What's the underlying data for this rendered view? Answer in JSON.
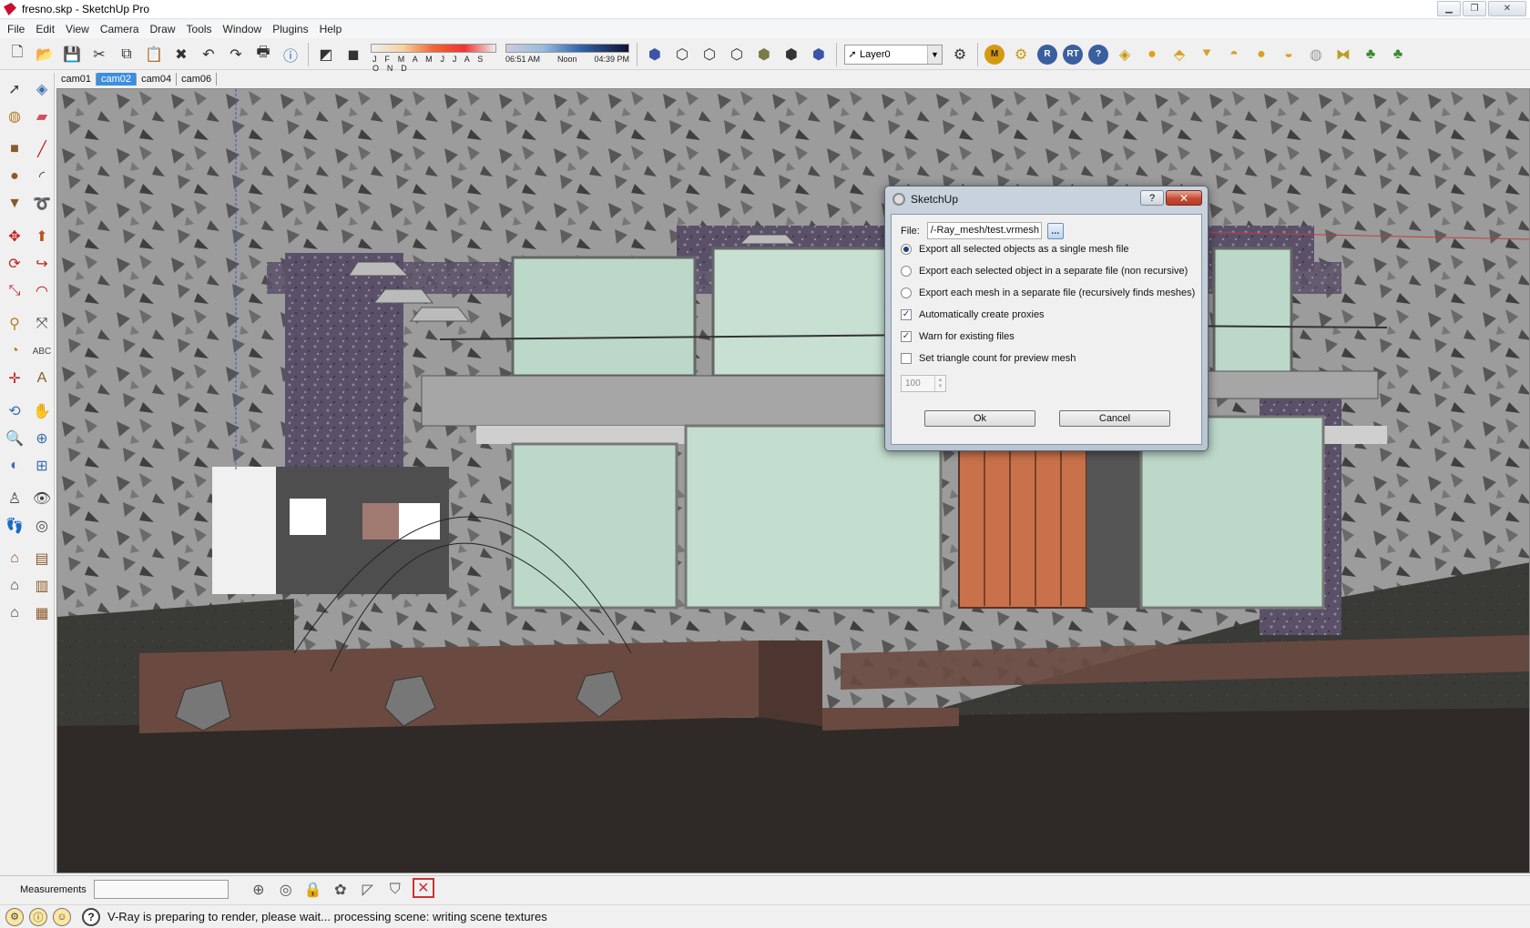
{
  "window": {
    "title": "fresno.skp - SketchUp Pro",
    "minimize_glyph": "▁",
    "restore_glyph": "❐",
    "close_glyph": "✕"
  },
  "menu": [
    "File",
    "Edit",
    "View",
    "Camera",
    "Draw",
    "Tools",
    "Window",
    "Plugins",
    "Help"
  ],
  "toolbar": {
    "months": "J F M A M J J A S O N D",
    "time_start": "06:51 AM",
    "time_noon": "Noon",
    "time_end": "04:39 PM",
    "layer": "Layer0",
    "vray_buttons": [
      "M",
      "R",
      "RT",
      "?"
    ]
  },
  "scene_tabs": [
    "cam01",
    "cam02",
    "cam04",
    "cam06"
  ],
  "active_tab": "cam02",
  "dialog": {
    "title": "SketchUp",
    "help_label": "?",
    "close_label": "✕",
    "file_label": "File:",
    "file_value": "/-Ray_mesh/test.vrmesh",
    "browse_label": "...",
    "options": [
      {
        "label": "Export all selected objects as a single mesh file",
        "checked": true
      },
      {
        "label": "Export each selected object in a separate file (non recursive)",
        "checked": false
      },
      {
        "label": "Export each mesh in a separate file (recursively finds meshes)",
        "checked": false
      }
    ],
    "checkboxes": [
      {
        "label": "Automatically create proxies",
        "checked": true
      },
      {
        "label": "Warn for existing files",
        "checked": true
      },
      {
        "label": "Set triangle count for preview mesh",
        "checked": false
      }
    ],
    "triangle_count": "100",
    "ok_label": "Ok",
    "cancel_label": "Cancel"
  },
  "measurements": {
    "label": "Measurements",
    "value": ""
  },
  "status": {
    "text": "V-Ray is preparing to render, please wait... processing scene: writing scene textures"
  },
  "colors": {
    "active_tab": "#3b8ee0",
    "sky": "#9a9a9a",
    "ground": "#2f2a27",
    "door": "#c8714a",
    "glass": "#bcd8c8"
  }
}
